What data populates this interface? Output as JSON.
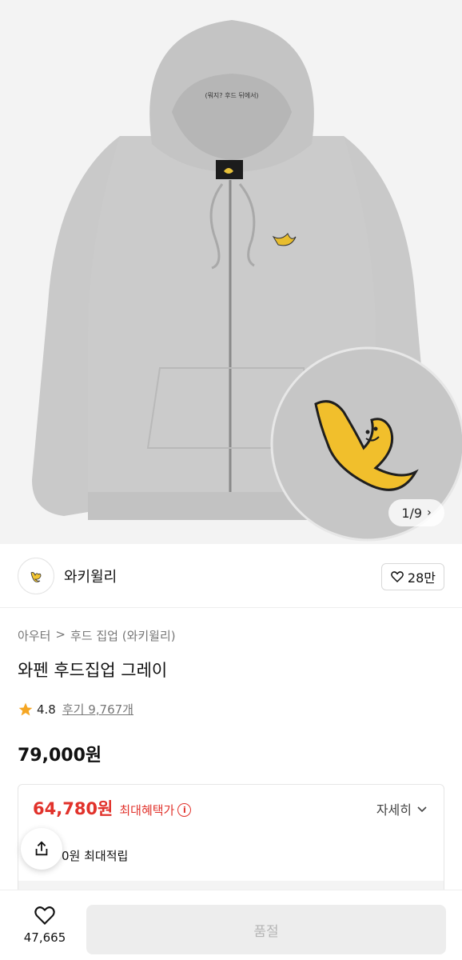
{
  "gallery": {
    "counter": "1/9",
    "hood_print": "(뭐지? 후드 뒤에서)"
  },
  "brand": {
    "name": "와키윌리",
    "likes": "28만"
  },
  "product": {
    "breadcrumb": [
      "아우터",
      ">",
      "후드 집업 (와키윌리)"
    ],
    "title": "와펜 후드집업 그레이",
    "rating": "4.8",
    "reviews": "후기 9,767개",
    "price": "79,000원"
  },
  "benefit": {
    "sale_price": "64,780원",
    "sale_label": "최대혜택가",
    "details": "자세히",
    "points": "0원 최대적립"
  },
  "bottom": {
    "wish_count": "47,665",
    "action": "품절"
  },
  "colors": {
    "accent_red": "#e1322b",
    "star": "#f5a623",
    "badge_yellow": "#f3c531"
  },
  "icons": [
    "heart-icon",
    "share-icon",
    "star-icon",
    "info-icon",
    "chevron-down-icon",
    "chevron-right-icon"
  ]
}
